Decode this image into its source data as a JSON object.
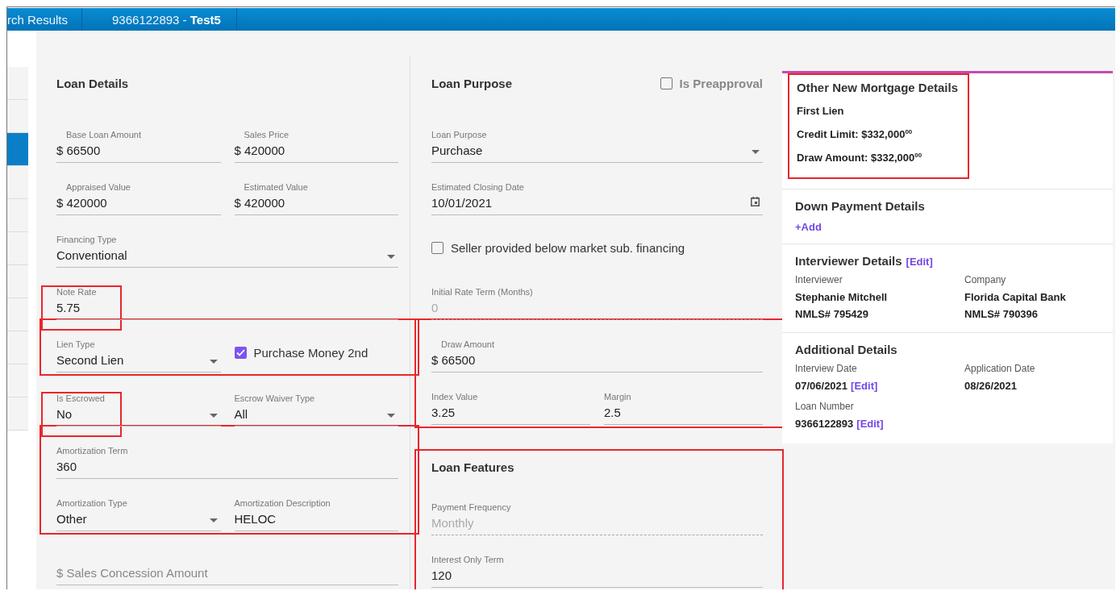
{
  "tabs": [
    {
      "label": "rch Results"
    },
    {
      "label": "9366122893 -",
      "name": "Test5"
    }
  ],
  "sidebar": {
    "items": [
      {
        "selected": false
      },
      {
        "selected": false
      },
      {
        "selected": true
      },
      {
        "selected": false
      },
      {
        "selected": false
      },
      {
        "selected": false
      },
      {
        "selected": false
      },
      {
        "selected": false
      },
      {
        "selected": false
      },
      {
        "selected": false
      },
      {
        "selected": false
      }
    ]
  },
  "loan_details": {
    "title": "Loan Details",
    "items": [
      {
        "kind": "row",
        "fields": [
          {
            "kind": "money",
            "label": "Base Loan Amount",
            "value": "$ 66500"
          },
          {
            "kind": "money",
            "label": "Sales Price",
            "value": "$ 420000"
          }
        ]
      },
      {
        "kind": "row",
        "fields": [
          {
            "kind": "money",
            "label": "Appraised Value",
            "value": "$ 420000"
          },
          {
            "kind": "money",
            "label": "Estimated Value",
            "value": "$ 420000"
          }
        ]
      },
      {
        "kind": "row",
        "fields": [
          {
            "kind": "select",
            "label": "Financing Type",
            "value": "Conventional"
          }
        ]
      },
      {
        "kind": "row",
        "fields": [
          {
            "kind": "text",
            "label": "Note Rate",
            "value": "5.75",
            "highlighted": true
          }
        ]
      },
      {
        "kind": "group",
        "highlighted": true,
        "rows": [
          {
            "kind": "row",
            "fields": [
              {
                "kind": "select",
                "label": "Lien Type",
                "value": "Second Lien"
              },
              {
                "kind": "checkbox",
                "label": "Purchase Money 2nd",
                "checked": true
              }
            ]
          }
        ]
      },
      {
        "kind": "row",
        "fields": [
          {
            "kind": "select",
            "label": "Is Escrowed",
            "value": "No",
            "highlighted": true
          },
          {
            "kind": "select",
            "label": "Escrow Waiver Type",
            "value": "All"
          }
        ]
      },
      {
        "kind": "group",
        "highlighted": true,
        "rows": [
          {
            "kind": "row",
            "fields": [
              {
                "kind": "text",
                "label": "Amortization Term",
                "value": "360"
              }
            ]
          },
          {
            "kind": "row",
            "fields": [
              {
                "kind": "select",
                "label": "Amortization Type",
                "value": "Other"
              },
              {
                "kind": "text",
                "label": "Amortization Description",
                "value": "HELOC"
              }
            ]
          }
        ]
      },
      {
        "kind": "row",
        "fields": [
          {
            "kind": "empty",
            "placeholder": "$ Sales Concession Amount"
          }
        ]
      }
    ]
  },
  "loan_purpose": {
    "title": "Loan Purpose",
    "preapproval": {
      "label": "Is Preapproval",
      "checked": false
    },
    "items": [
      {
        "kind": "row",
        "fields": [
          {
            "kind": "select",
            "label": "Loan Purpose",
            "value": "Purchase"
          }
        ]
      },
      {
        "kind": "row",
        "fields": [
          {
            "kind": "date",
            "label": "Estimated Closing Date",
            "value": "10/01/2021"
          }
        ]
      },
      {
        "kind": "row",
        "fields": [
          {
            "kind": "checkbox",
            "label": "Seller provided below market sub. financing",
            "checked": false
          }
        ]
      },
      {
        "kind": "row",
        "fields": [
          {
            "kind": "disabled",
            "label": "Initial Rate Term (Months)",
            "value": "0"
          }
        ]
      },
      {
        "kind": "group",
        "highlighted": true,
        "rows": [
          {
            "kind": "row",
            "fields": [
              {
                "kind": "money",
                "label": "Draw Amount",
                "value": "$ 66500"
              }
            ]
          },
          {
            "kind": "row",
            "fields": [
              {
                "kind": "text",
                "label": "Index Value",
                "value": "3.25"
              },
              {
                "kind": "text",
                "label": "Margin",
                "value": "2.5"
              }
            ]
          }
        ]
      },
      {
        "kind": "group",
        "highlighted": true,
        "title": "Loan Features",
        "rows": [
          {
            "kind": "row",
            "fields": [
              {
                "kind": "disabled",
                "label": "Payment Frequency",
                "value": "Monthly"
              }
            ]
          },
          {
            "kind": "row",
            "fields": [
              {
                "kind": "text",
                "label": "Interest Only Term",
                "value": "120"
              }
            ]
          }
        ]
      }
    ]
  },
  "details": {
    "sections": [
      {
        "kind": "lines",
        "title": "Other New Mortgage Details",
        "highlighted": true,
        "lines": [
          "First Lien",
          "Credit Limit: $332,000$^{00}$",
          "Draw Amount: $332,000$^{00}$"
        ]
      },
      {
        "kind": "add",
        "title": "Down Payment Details",
        "link": "+Add"
      },
      {
        "kind": "pairs",
        "title": "Interviewer Details",
        "edit": "[Edit]",
        "pairs": [
          {
            "label": "Interviewer",
            "lines": [
              "Stephanie Mitchell",
              "NMLS# 795429"
            ]
          },
          {
            "label": "Company",
            "lines": [
              "Florida Capital Bank",
              "NMLS# 790396"
            ]
          }
        ]
      },
      {
        "kind": "pairs",
        "title": "Additional Details",
        "pairs": [
          {
            "label": "Interview Date",
            "lines": [
              "07/06/2021"
            ],
            "edit": "[Edit]"
          },
          {
            "label": "Application Date",
            "lines": [
              "08/26/2021"
            ]
          },
          {
            "label": "Loan Number",
            "lines": [
              "9366122893"
            ],
            "edit": "[Edit]"
          }
        ]
      }
    ]
  }
}
